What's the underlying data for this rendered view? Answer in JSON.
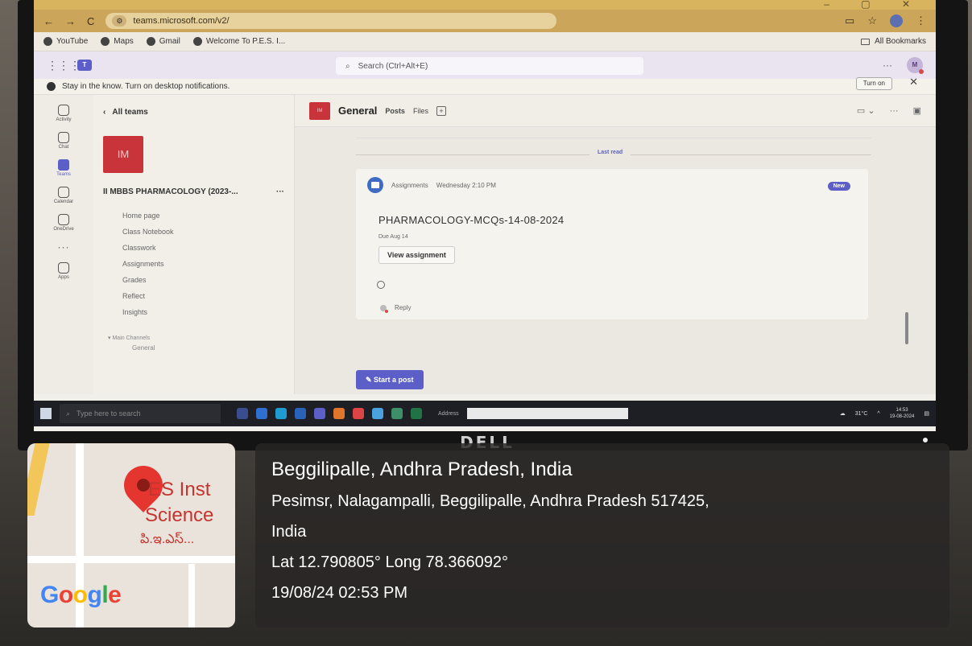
{
  "browser": {
    "url": "teams.microsoft.com/v2/",
    "bookmarks": [
      "YouTube",
      "Maps",
      "Gmail",
      "Welcome To P.E.S. I..."
    ],
    "all_bookmarks": "All Bookmarks"
  },
  "teams": {
    "search_placeholder": "Search (Ctrl+Alt+E)",
    "me_initials": "M",
    "banner_text": "Stay in the know. Turn on desktop notifications.",
    "banner_button": "Turn on",
    "rail": [
      {
        "label": "Activity",
        "icon": "bell-icon"
      },
      {
        "label": "Chat",
        "icon": "chat-icon"
      },
      {
        "label": "Teams",
        "icon": "teams-icon"
      },
      {
        "label": "Calendar",
        "icon": "calendar-icon"
      },
      {
        "label": "OneDrive",
        "icon": "cloud-icon"
      },
      {
        "label": "Apps",
        "icon": "apps-icon"
      }
    ],
    "back_label": "All teams",
    "team_initials": "IM",
    "team_name": "II MBBS PHARMACOLOGY (2023-...",
    "nav": [
      "Home page",
      "Class Notebook",
      "Classwork",
      "Assignments",
      "Grades",
      "Reflect",
      "Insights"
    ],
    "channels_header": "Main Channels",
    "channels": [
      "General"
    ],
    "channel": {
      "name": "General",
      "tabs": [
        "Posts",
        "Files"
      ]
    },
    "feed": {
      "last_read": "Last read",
      "post": {
        "author": "Assignments",
        "time": "Wednesday 2:10 PM",
        "badge": "New",
        "title": "PHARMACOLOGY-MCQs-14-08-2024",
        "due": "Due Aug 14",
        "button": "View assignment"
      },
      "reply": "Reply",
      "start_post": "Start a post"
    }
  },
  "taskbar": {
    "search_placeholder": "Type here to search",
    "address_label": "Address",
    "weather": "31°C",
    "time": "14:53",
    "date": "19-08-2024"
  },
  "monitor": {
    "brand": "DELL"
  },
  "geotag": {
    "map_label_1": "ES Inst",
    "map_label_2": "Science",
    "map_label_3": "పి.ఇ.ఎస్...",
    "title": "Beggilipalle, Andhra Pradesh, India",
    "address_line1": "Pesimsr, Nalagampalli, Beggilipalle, Andhra Pradesh 517425,",
    "address_line2": "India",
    "coords": "Lat 12.790805° Long 78.366092°",
    "datetime": "19/08/24 02:53 PM"
  }
}
